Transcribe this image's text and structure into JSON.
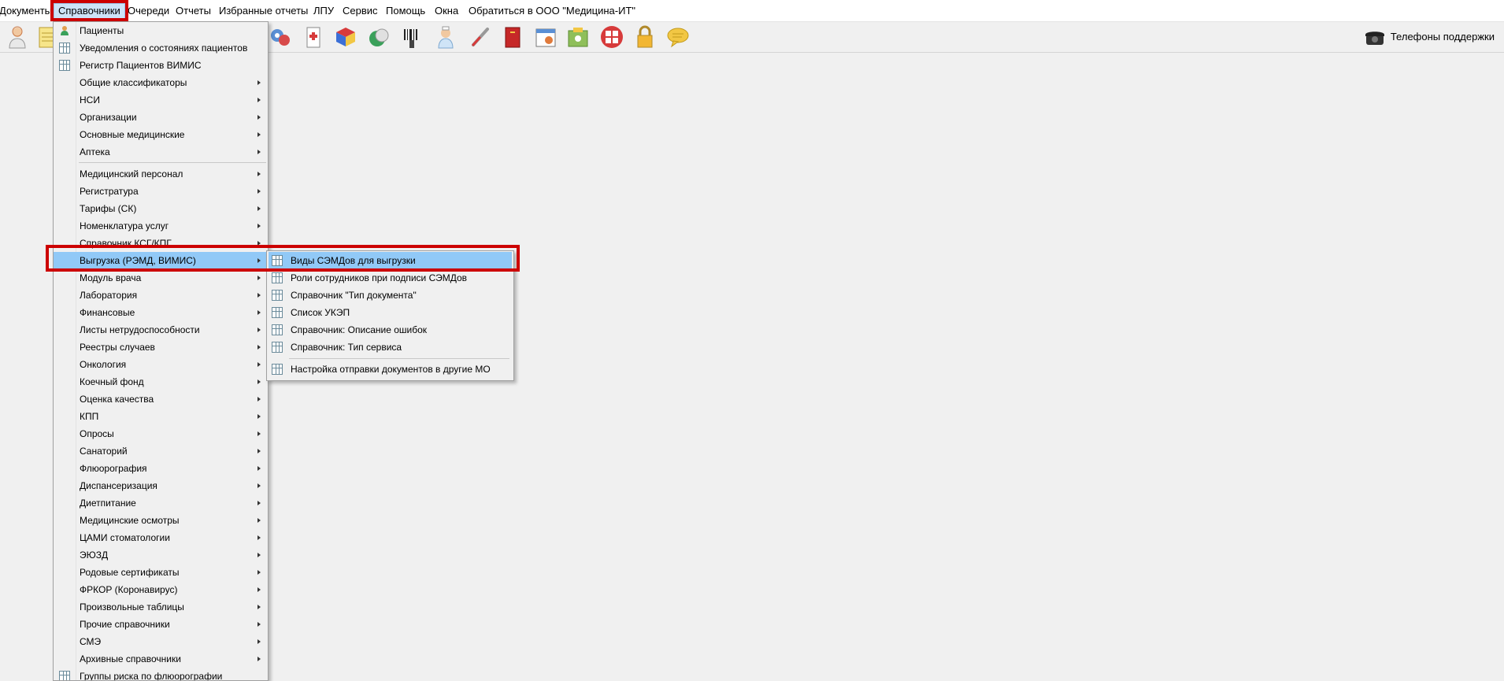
{
  "menubar": {
    "items": [
      {
        "label": "Документы"
      },
      {
        "label": "Справочники"
      },
      {
        "label": "Очереди"
      },
      {
        "label": "Отчеты"
      },
      {
        "label": "Избранные отчеты"
      },
      {
        "label": "ЛПУ"
      },
      {
        "label": "Сервис"
      },
      {
        "label": "Помощь"
      },
      {
        "label": "Окна"
      },
      {
        "label": "Обратиться в ООО \"Медицина-ИТ\""
      }
    ]
  },
  "toolbar": {
    "icons": [
      "doctor-icon",
      "notepad-icon",
      "stethoscope-icon",
      "medical-record-icon",
      "rubik-icon",
      "pills-icon",
      "barcode-scanner-icon",
      "nurse-icon",
      "thermometer-icon",
      "red-book-icon",
      "calendar-window-icon",
      "folder-users-icon",
      "life-ring-icon",
      "padlock-icon",
      "chat-bubble-icon"
    ],
    "colors": {
      "accent": "#f2c744",
      "red": "#d73b3b",
      "blue": "#3b6fd7"
    }
  },
  "support": {
    "label": "Телефоны поддержки",
    "icon": "telephone-icon"
  },
  "dropdown": {
    "items": [
      {
        "label": "Пациенты",
        "icon": "patients-icon",
        "submenu": false
      },
      {
        "label": "Уведомления о состояниях пациентов",
        "icon": "table-icon",
        "submenu": false
      },
      {
        "label": "Регистр Пациентов ВИМИС",
        "icon": "table-icon",
        "submenu": false
      },
      {
        "label": "Общие классификаторы",
        "submenu": true
      },
      {
        "label": "НСИ",
        "submenu": true
      },
      {
        "label": "Организации",
        "submenu": true
      },
      {
        "label": "Основные медицинские",
        "submenu": true
      },
      {
        "label": "Аптека",
        "submenu": true
      },
      {
        "label": "Медицинский персонал",
        "submenu": true
      },
      {
        "label": "Регистратура",
        "submenu": true
      },
      {
        "label": "Тарифы (СК)",
        "submenu": true
      },
      {
        "label": "Номенклатура услуг",
        "submenu": true
      },
      {
        "label": "Справочник КСГ/КПГ",
        "submenu": true
      },
      {
        "label": "Выгрузка (РЭМД, ВИМИС)",
        "submenu": true,
        "highlighted": true
      },
      {
        "label": "Модуль врача",
        "submenu": true
      },
      {
        "label": "Лаборатория",
        "submenu": true
      },
      {
        "label": "Финансовые",
        "submenu": true
      },
      {
        "label": "Листы нетрудоспособности",
        "submenu": true
      },
      {
        "label": "Реестры случаев",
        "submenu": true
      },
      {
        "label": "Онкология",
        "submenu": true
      },
      {
        "label": "Коечный фонд",
        "submenu": true
      },
      {
        "label": "Оценка качества",
        "submenu": true
      },
      {
        "label": "КПП",
        "submenu": true
      },
      {
        "label": "Опросы",
        "submenu": true
      },
      {
        "label": "Санаторий",
        "submenu": true
      },
      {
        "label": "Флюорография",
        "submenu": true
      },
      {
        "label": "Диспансеризация",
        "submenu": true
      },
      {
        "label": "Диетпитание",
        "submenu": true
      },
      {
        "label": "Медицинские осмотры",
        "submenu": true
      },
      {
        "label": "ЦАМИ стоматологии",
        "submenu": true
      },
      {
        "label": "ЭЮЗД",
        "submenu": true
      },
      {
        "label": "Родовые сертификаты",
        "submenu": true
      },
      {
        "label": "ФРКОР (Коронавирус)",
        "submenu": true
      },
      {
        "label": "Произвольные таблицы",
        "submenu": true
      },
      {
        "label": "Прочие справочники",
        "submenu": true
      },
      {
        "label": "СМЭ",
        "submenu": true
      },
      {
        "label": "Архивные справочники",
        "submenu": true
      },
      {
        "label": "Группы риска по флюорографии",
        "icon": "table-icon",
        "submenu": false
      }
    ]
  },
  "submenu": {
    "items": [
      {
        "label": "Виды СЭМДов для выгрузки",
        "highlighted": true
      },
      {
        "label": "Роли сотрудников при подписи СЭМДов"
      },
      {
        "label": "Справочник \"Тип документа\""
      },
      {
        "label": "Список УКЭП"
      },
      {
        "label": "Справочник: Описание ошибок"
      },
      {
        "label": "Справочник: Тип сервиса"
      },
      {
        "label": "Настройка отправки документов в другие МО"
      }
    ]
  },
  "highlight_color": "#cc0000"
}
